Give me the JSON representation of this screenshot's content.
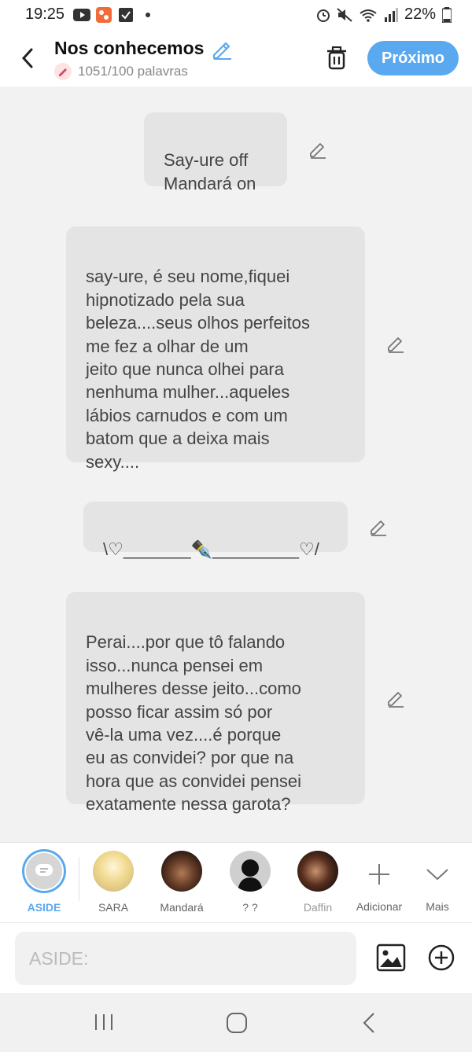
{
  "status_bar": {
    "time": "19:25",
    "battery": "22%",
    "icons_left": [
      "youtube-icon",
      "app-icon",
      "check-icon",
      "dot-icon"
    ],
    "icons_right": [
      "alarm-icon",
      "mute-icon",
      "wifi-icon",
      "signal-icon",
      "battery-icon"
    ]
  },
  "header": {
    "title": "Nos conhecemos",
    "word_count": "1051/100 palavras",
    "next_label": "Próximo"
  },
  "messages": [
    {
      "text": "Say-ure off\nMandará on"
    },
    {
      "text": "say-ure, é seu nome,fiquei\nhipnotizado pela sua\nbeleza....seus olhos perfeitos\nme fez a olhar de um\njeito que nunca olhei para\nnenhuma mulher...aqueles\nlábios carnudos e com um\nbatom que a deixa mais\nsexy...."
    },
    {
      "text": "\\♡_______✒️_________♡/"
    },
    {
      "text": "Perai....por que tô falando\nisso...nunca pensei em\nmulheres desse jeito...como\nposso ficar assim só por\nvê-la uma vez....é porque\neu as convidei? por que na\nhora que as convidei pensei\nexatamente nessa garota?"
    }
  ],
  "characters": [
    {
      "name": "ASIDE"
    },
    {
      "name": "SARA"
    },
    {
      "name": "Mandará"
    },
    {
      "name": "? ?"
    },
    {
      "name": "Daffin"
    }
  ],
  "char_actions": {
    "add_label": "Adicionar",
    "more_label": "Mais"
  },
  "input": {
    "placeholder": "ASIDE:"
  },
  "colors": {
    "accent": "#5aa8ef",
    "aside_selected": "#5aa8ef",
    "bubble": "#e4e4e4"
  }
}
